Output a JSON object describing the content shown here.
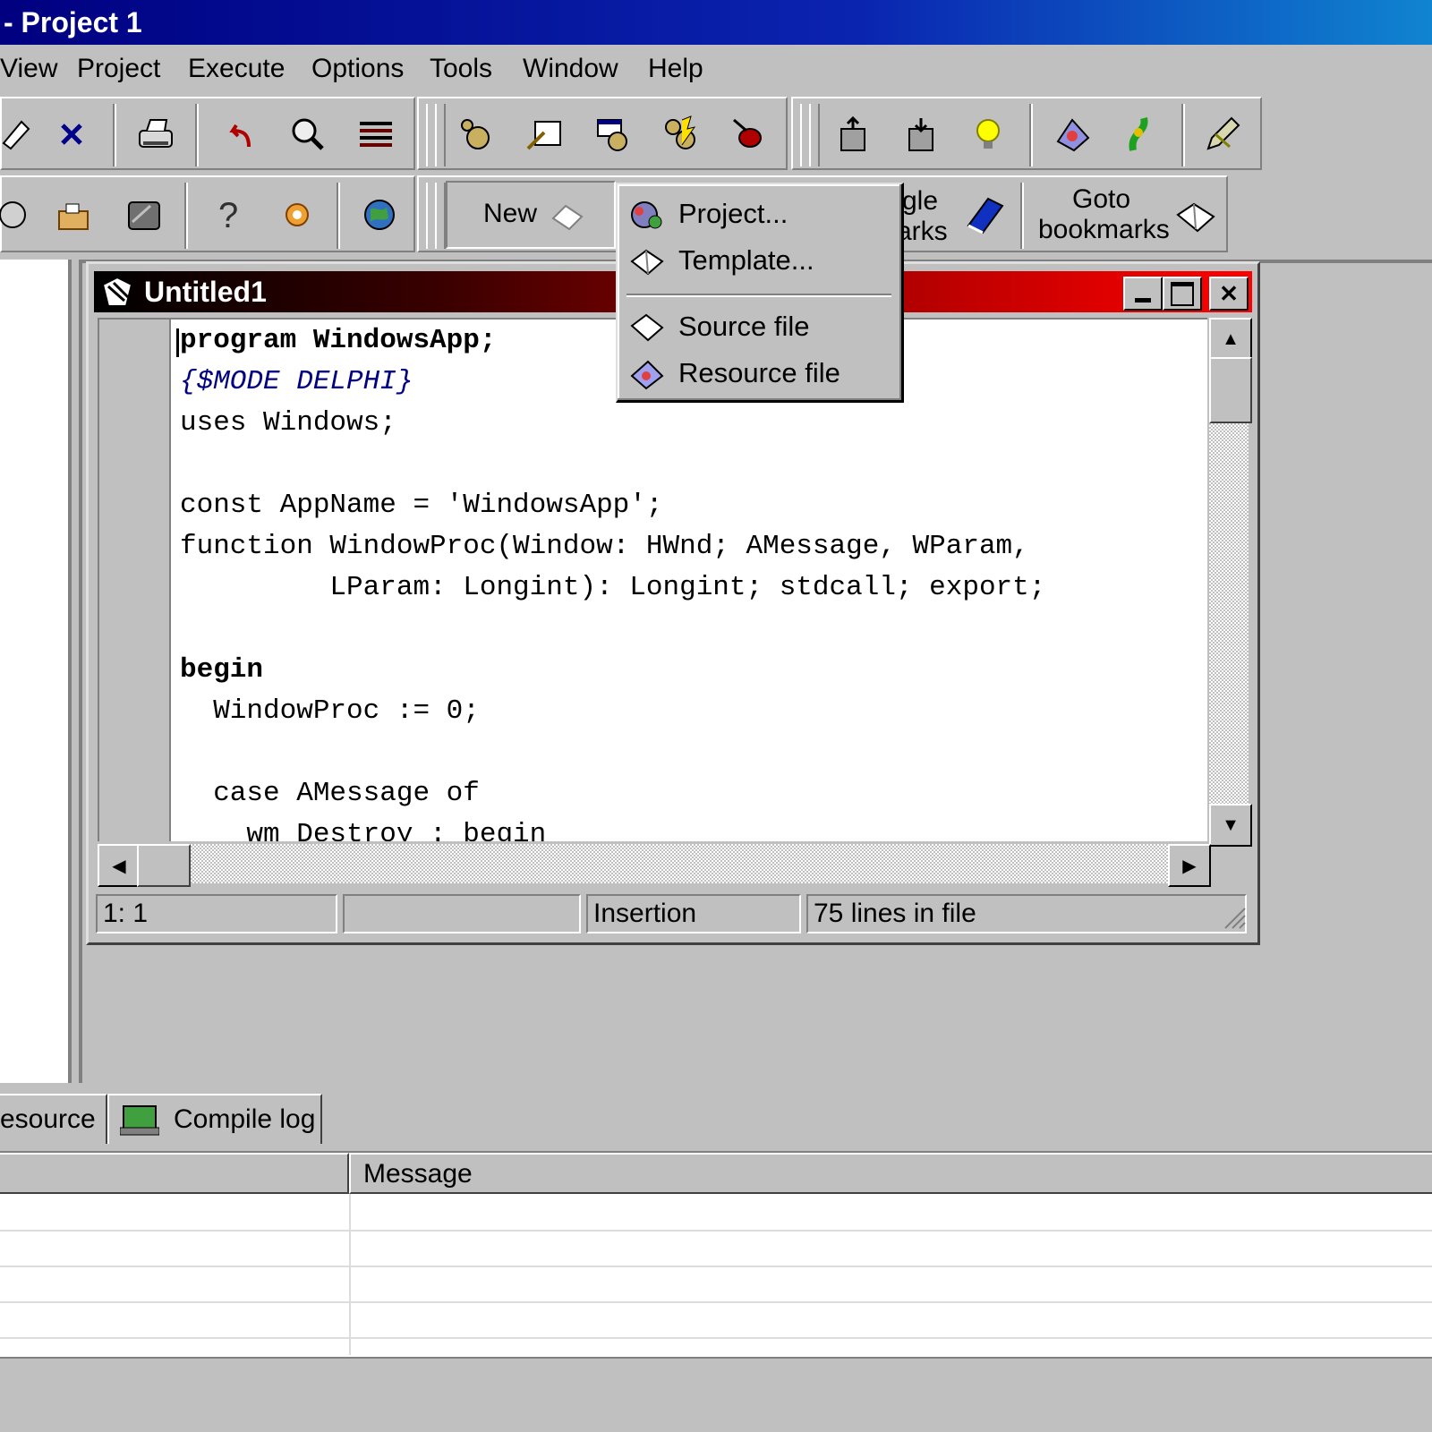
{
  "window": {
    "title": "- Project 1"
  },
  "menubar": {
    "items": [
      {
        "label": "View",
        "accel": "V"
      },
      {
        "label": "Project",
        "accel": "P"
      },
      {
        "label": "Execute",
        "accel": "x"
      },
      {
        "label": "Options",
        "accel": "O"
      },
      {
        "label": "Tools",
        "accel": "T"
      },
      {
        "label": "Window",
        "accel": "W"
      },
      {
        "label": "Help",
        "accel": "H"
      }
    ]
  },
  "toolbar2": {
    "new_label": "New",
    "toggle_bookmarks_label_line1": "gle",
    "toggle_bookmarks_label_line2": "arks",
    "goto_bookmarks_label_line1": "Goto",
    "goto_bookmarks_label_line2": "bookmarks"
  },
  "new_menu": {
    "items": [
      {
        "label": "Project...",
        "icon": "project-icon"
      },
      {
        "label": "Template...",
        "icon": "template-icon"
      },
      {
        "label": "Source file",
        "icon": "source-file-icon"
      },
      {
        "label": "Resource file",
        "icon": "resource-file-icon"
      }
    ]
  },
  "editor": {
    "title": "Untitled1",
    "lines": [
      "program WindowsApp;",
      "{$MODE DELPHI}",
      "uses Windows;",
      "",
      "const AppName = 'WindowsApp';",
      "function WindowProc(Window: HWnd; AMessage, WParam,",
      "         LParam: Longint): Longint; stdcall; export;",
      "",
      "begin",
      "  WindowProc := 0;",
      "",
      "  case AMessage of",
      "    wm_Destroy : begin"
    ],
    "status": {
      "position": "1: 1",
      "modified": "",
      "mode": "Insertion",
      "lines_info": "75 lines in file"
    }
  },
  "bottom_tabs": {
    "tab1": "esource",
    "tab2": "Compile log"
  },
  "log": {
    "columns": [
      "",
      "Message"
    ]
  }
}
